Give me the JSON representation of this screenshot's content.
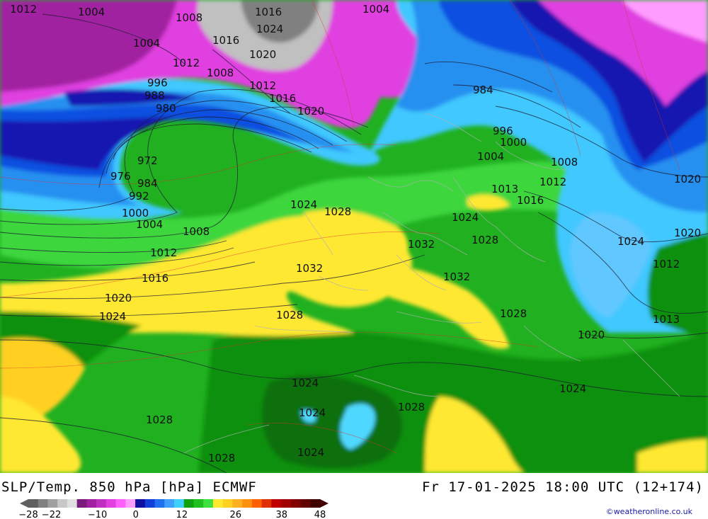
{
  "title": "SLP/Temp. 850 hPa [hPa] ECMWF",
  "valid_time": "Fr 17-01-2025 18:00 UTC (12+174)",
  "credit": "©weatheronline.co.uk",
  "legend": {
    "colors": [
      "#606060",
      "#808080",
      "#a0a0a0",
      "#c8c8c8",
      "#e0e0e0",
      "#7a1a7a",
      "#a020a0",
      "#c030c0",
      "#e040e0",
      "#ff60ff",
      "#ff9cff",
      "#1010a0",
      "#1040d8",
      "#2070f0",
      "#40a0ff",
      "#40d0ff",
      "#10a010",
      "#20c020",
      "#40e040",
      "#ffe830",
      "#ffd020",
      "#ffb020",
      "#ff9010",
      "#ff6000",
      "#e03000",
      "#c00000",
      "#a00000",
      "#800000",
      "#600000",
      "#400000"
    ],
    "ticks": [
      "-28",
      "-22",
      "-10",
      "0",
      "12",
      "26",
      "38",
      "48"
    ]
  },
  "isobar_labels": [
    "1012",
    "1004",
    "1008",
    "1016",
    "1024",
    "1004",
    "1004",
    "1016",
    "1020",
    "1012",
    "1008",
    "996",
    "988",
    "980",
    "1016",
    "1012",
    "1020",
    "984",
    "972",
    "976",
    "984",
    "992",
    "1000",
    "1004",
    "1008",
    "1012",
    "1016",
    "1020",
    "1024",
    "1024",
    "1028",
    "1032",
    "1028",
    "1032",
    "1028",
    "1024",
    "1032",
    "1028",
    "1028",
    "1020",
    "1024",
    "1024",
    "1024",
    "1028",
    "1028",
    "1024",
    "1024",
    "1013",
    "1012",
    "1016",
    "1008",
    "1004",
    "1000",
    "996",
    "1020",
    "1020",
    "1016",
    "1012",
    "1013",
    "1020"
  ]
}
